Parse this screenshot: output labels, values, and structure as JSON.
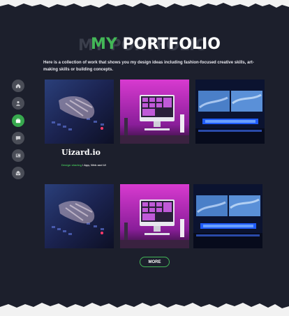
{
  "header": {
    "ghost_title": "MY PORTFOLIO",
    "title_highlight": "MY",
    "title_rest": " PORTFOLIO"
  },
  "intro": "Here is a collection of work that shows you my design ideas including fashion-focused creative skills, art-making skills or building concepts.",
  "sidebar": {
    "items": [
      {
        "icon": "home-icon"
      },
      {
        "icon": "user-icon"
      },
      {
        "icon": "briefcase-icon",
        "active": true
      },
      {
        "icon": "chat-icon"
      },
      {
        "icon": "news-icon"
      },
      {
        "icon": "mail-icon"
      }
    ]
  },
  "featured": {
    "brand": "Uizard.io",
    "category": "Design sharing",
    "tags": " / App, Web and UI"
  },
  "more_button": "MORE",
  "colors": {
    "background": "#1c1f2c",
    "accent": "#43b757",
    "sidebar_button": "#4a4d57"
  }
}
